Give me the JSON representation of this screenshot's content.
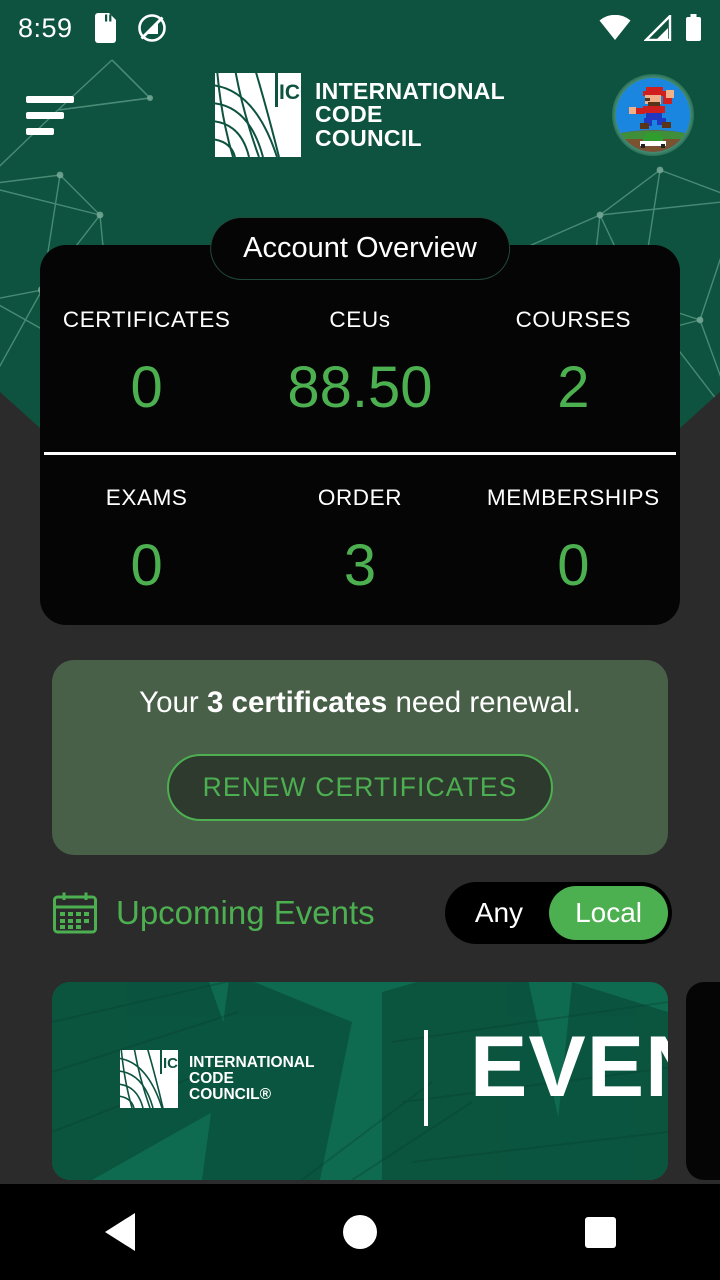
{
  "status_bar": {
    "time": "8:59",
    "icons_left": [
      "sd-card-icon",
      "dnd-off-icon"
    ],
    "icons_right": [
      "wifi-icon",
      "cellular-signal-icon",
      "battery-icon"
    ]
  },
  "app_bar": {
    "menu_icon": "hamburger-menu-icon",
    "brand": {
      "mark_text": "ICC",
      "line1": "INTERNATIONAL",
      "line2": "CODE",
      "line3": "COUNCIL"
    },
    "avatar": "user-avatar"
  },
  "overview": {
    "badge": "Account Overview",
    "row1": [
      {
        "label": "CERTIFICATES",
        "value": "0"
      },
      {
        "label": "CEUs",
        "value": "88.50"
      },
      {
        "label": "COURSES",
        "value": "2"
      }
    ],
    "row2": [
      {
        "label": "EXAMS",
        "value": "0"
      },
      {
        "label": "ORDER",
        "value": "3"
      },
      {
        "label": "MEMBERSHIPS",
        "value": "0"
      }
    ]
  },
  "renewal": {
    "prefix": "Your ",
    "highlight": "3 certificates",
    "suffix": " need renewal.",
    "button": "RENEW CERTIFICATES"
  },
  "events": {
    "icon": "calendar-icon",
    "title": "Upcoming Events",
    "filter": {
      "options": [
        "Any",
        "Local"
      ],
      "selected": "Local"
    },
    "cards": [
      {
        "brand_mark": "ICC",
        "line1": "INTERNATIONAL",
        "line2": "CODE",
        "line3": "COUNCIL®",
        "word": "EVENT"
      }
    ]
  },
  "nav_bar": {
    "back": "back-button",
    "home": "home-button",
    "recents": "recents-button"
  },
  "colors": {
    "brand_green": "#0d5340",
    "accent_green": "#4caf50",
    "page_bg": "#2b2b2b",
    "card_black": "#050505",
    "banner_green": "#485f48"
  }
}
